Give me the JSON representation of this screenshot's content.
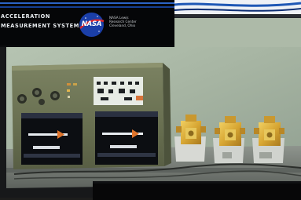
{
  "header": {
    "line_1": "ACCELERATION",
    "line_2": "MEASUREMENT SYSTEM",
    "logo": "NASA",
    "center_name": "NASA Lewis\nResearch Center\nCleveland, Ohio"
  },
  "photo": {
    "subject": "laboratory hardware on a bench",
    "colors": {
      "wall": "#a9b6a5",
      "enclosure": "#6f7655",
      "enclosure_edge": "#4f553e",
      "sensor_housing": "#d8ad3c",
      "bench": "#7f8680",
      "panel_black": "#0c0e12",
      "label_white": "#eaeee9",
      "accent_orange": "#e0742b"
    }
  }
}
